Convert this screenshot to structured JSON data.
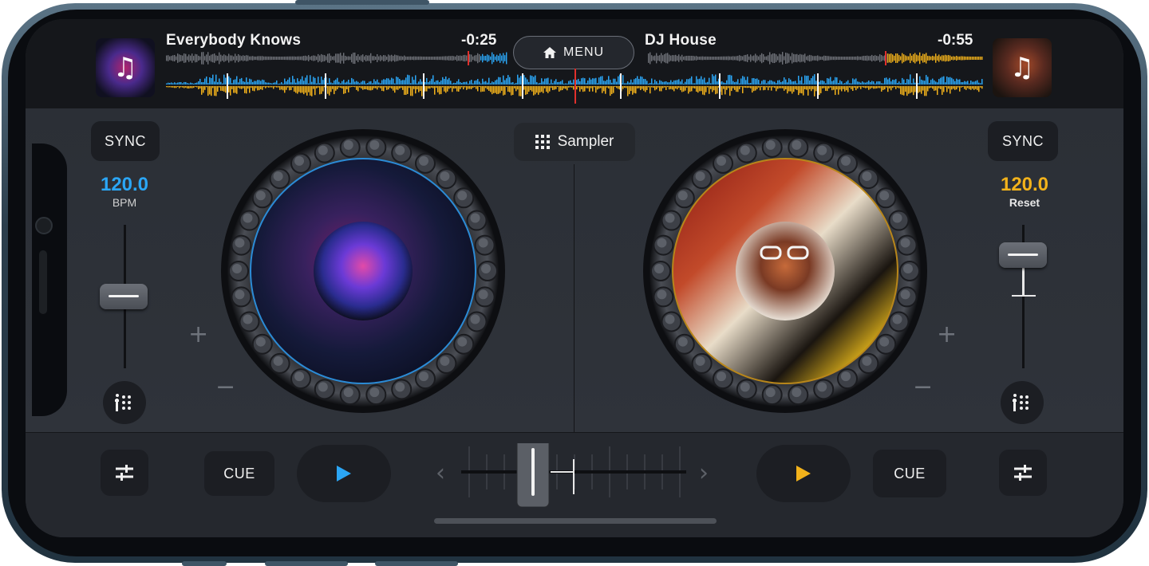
{
  "deck_left": {
    "title": "Everybody Knows",
    "time_remaining": "-0:25",
    "sync_label": "SYNC",
    "bpm": "120.0",
    "bpm_sub": "BPM",
    "cue_label": "CUE",
    "accent": "#2ba6f5",
    "pitch_position": 0.5
  },
  "deck_right": {
    "title": "DJ House",
    "time_remaining": "-0:55",
    "sync_label": "SYNC",
    "bpm": "120.0",
    "bpm_sub": "Reset",
    "cue_label": "CUE",
    "accent": "#f2b21b",
    "pitch_position": 0.2
  },
  "header": {
    "menu_label": "MENU"
  },
  "center": {
    "sampler_label": "Sampler",
    "crossfader_position": 0.3
  },
  "icons": {
    "album_note": "♫",
    "plus": "+",
    "minus": "−",
    "chevron_left": "‹",
    "chevron_right": "›"
  },
  "colors": {
    "waveform_blue": "#2ba6f5",
    "waveform_yellow": "#f2b21b",
    "playhead": "#e0302c"
  }
}
